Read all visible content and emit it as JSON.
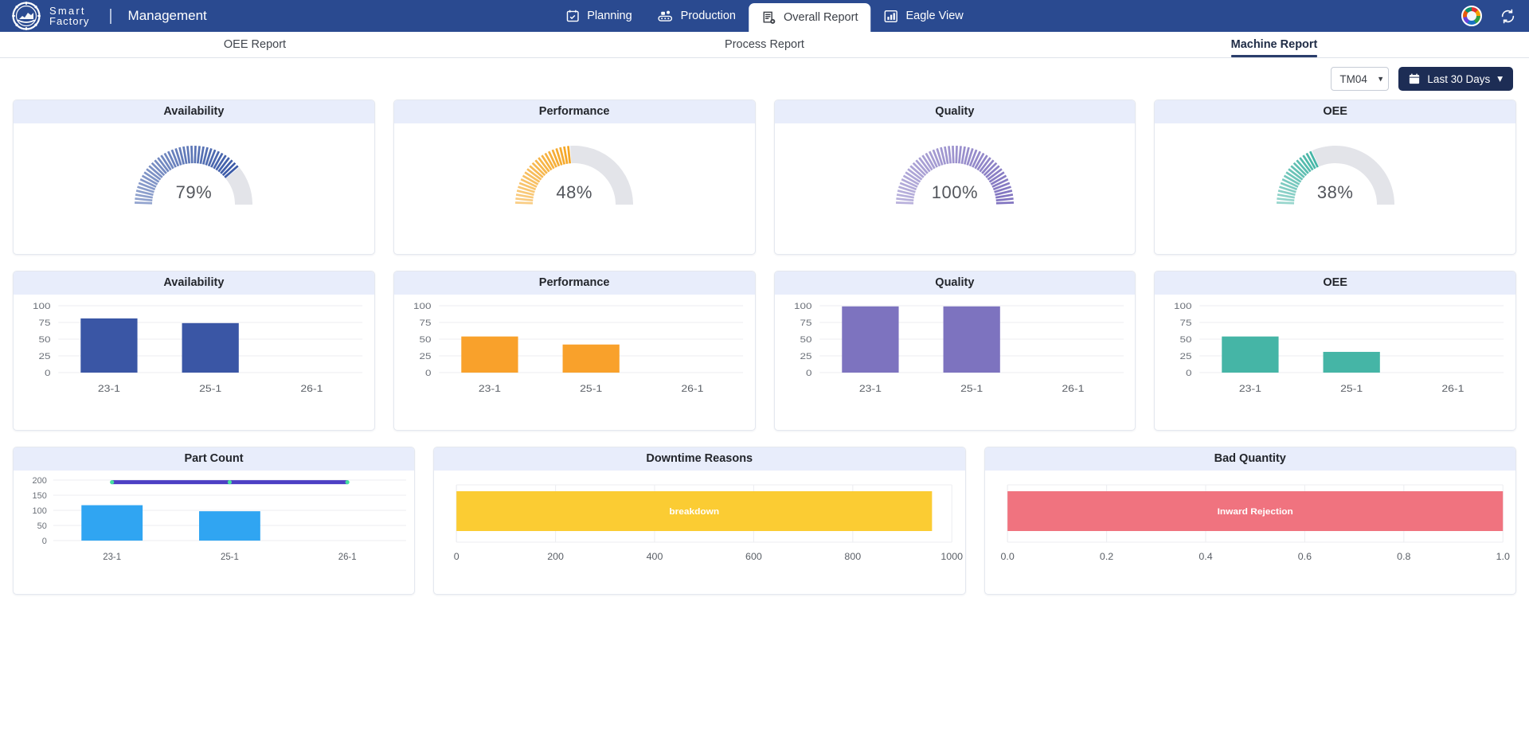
{
  "header": {
    "brand_line1": "Smart",
    "brand_line2": "Factory",
    "divider": "|",
    "title": "Management",
    "nav": [
      {
        "label": "Planning",
        "icon": "calendar-check-icon",
        "active": false
      },
      {
        "label": "Production",
        "icon": "conveyor-icon",
        "active": false
      },
      {
        "label": "Overall Report",
        "icon": "report-gear-icon",
        "active": true
      },
      {
        "label": "Eagle View",
        "icon": "bar-chart-icon",
        "active": false
      }
    ],
    "avatar_icon": "user-avatar",
    "sync_icon": "sync-refresh-icon",
    "background_color": "#2a4a90"
  },
  "subtabs": [
    {
      "label": "OEE Report",
      "active": false
    },
    {
      "label": "Process Report",
      "active": false
    },
    {
      "label": "Machine Report",
      "active": true
    }
  ],
  "filters": {
    "machine_selected": "TM04",
    "machine_options": [
      "TM04"
    ],
    "date_range_label": "Last 30 Days",
    "calendar_icon": "calendar-icon",
    "chevron_icon": "chevron-down-icon"
  },
  "gauges": [
    {
      "title": "Availability",
      "value_label": "79%",
      "value": 79,
      "color": "#3c5ba8"
    },
    {
      "title": "Performance",
      "value_label": "48%",
      "value": 48,
      "color": "#f5a623"
    },
    {
      "title": "Quality",
      "value_label": "100%",
      "value": 100,
      "color": "#8073c0"
    },
    {
      "title": "OEE",
      "value_label": "38%",
      "value": 38,
      "color": "#45b5a6"
    }
  ],
  "chart_data": [
    {
      "type": "bar",
      "title": "Availability",
      "categories": [
        "23-1",
        "25-1",
        "26-1"
      ],
      "values": [
        81,
        74,
        0
      ],
      "ylim": [
        0,
        100
      ],
      "yticks": [
        0,
        25,
        50,
        75,
        100
      ],
      "color": "#3a56a5",
      "xlabel": "",
      "ylabel": "",
      "grid": true,
      "legend": "none"
    },
    {
      "type": "bar",
      "title": "Performance",
      "categories": [
        "23-1",
        "25-1",
        "26-1"
      ],
      "values": [
        54,
        42,
        0
      ],
      "ylim": [
        0,
        100
      ],
      "yticks": [
        0,
        25,
        50,
        75,
        100
      ],
      "color": "#f9a12b",
      "xlabel": "",
      "ylabel": "",
      "grid": true,
      "legend": "none"
    },
    {
      "type": "bar",
      "title": "Quality",
      "categories": [
        "23-1",
        "25-1",
        "26-1"
      ],
      "values": [
        99,
        99,
        0
      ],
      "ylim": [
        0,
        100
      ],
      "yticks": [
        0,
        25,
        50,
        75,
        100
      ],
      "color": "#7d73bf",
      "xlabel": "",
      "ylabel": "",
      "grid": true,
      "legend": "none"
    },
    {
      "type": "bar",
      "title": "OEE",
      "categories": [
        "23-1",
        "25-1",
        "26-1"
      ],
      "values": [
        54,
        31,
        0
      ],
      "ylim": [
        0,
        100
      ],
      "yticks": [
        0,
        25,
        50,
        75,
        100
      ],
      "color": "#45b5a6",
      "xlabel": "",
      "ylabel": "",
      "grid": true,
      "legend": "none"
    },
    {
      "type": "bar",
      "title": "Part Count",
      "categories": [
        "23-1",
        "25-1",
        "26-1"
      ],
      "series": [
        {
          "name": "part-count-bars",
          "type": "bar",
          "values": [
            117,
            97,
            0
          ],
          "color": "#30a5f2"
        },
        {
          "name": "target-line",
          "type": "line",
          "values": [
            193,
            193,
            193
          ],
          "color": "#4d3fc4",
          "marker_color": "#44dfa0"
        }
      ],
      "ylim": [
        0,
        200
      ],
      "yticks": [
        0,
        50,
        100,
        150,
        200
      ],
      "xlabel": "",
      "ylabel": "",
      "grid": true,
      "legend": "none"
    },
    {
      "type": "bar",
      "orientation": "horizontal",
      "title": "Downtime Reasons",
      "categories": [
        "breakdown"
      ],
      "values": [
        960
      ],
      "xlim": [
        0,
        1000
      ],
      "xticks": [
        "0",
        "200",
        "400",
        "600",
        "800",
        "1000"
      ],
      "color": "#fbcc33",
      "xlabel": "",
      "ylabel": "",
      "grid": true,
      "legend": "none"
    },
    {
      "type": "bar",
      "orientation": "horizontal",
      "title": "Bad Quantity",
      "categories": [
        "Inward Rejection"
      ],
      "values": [
        1.0
      ],
      "xlim": [
        0,
        1.0
      ],
      "xticks": [
        "0.0",
        "0.2",
        "0.4",
        "0.6",
        "0.8",
        "1.0"
      ],
      "color": "#f0737f",
      "xlabel": "",
      "ylabel": "",
      "grid": true,
      "legend": "none"
    }
  ]
}
